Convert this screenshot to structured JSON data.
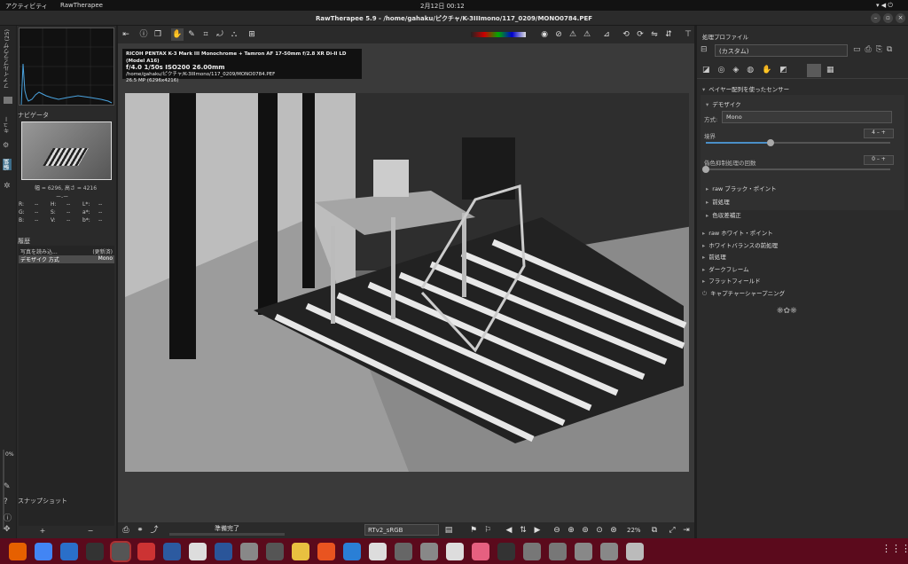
{
  "topbar": {
    "activities": "アクティビティ",
    "app": "RawTherapee",
    "clock": "2月12日  00:12"
  },
  "title": "RawTherapee 5.9 - /home/gahaku/ピクチャ/K-3IIImono/117_0209/MONO0784.PEF",
  "left_tabs": {
    "filebrowser": "ファイルブラウザ (25)",
    "queue": "キュー",
    "edit": "編集"
  },
  "left": {
    "navigator": "ナビゲータ",
    "size": "幅 = 6296, 高さ = 4216",
    "nan": "ー-ー",
    "readout": [
      [
        "R:",
        "--",
        "H:",
        "--",
        "L*:",
        "--"
      ],
      [
        "G:",
        "--",
        "S:",
        "--",
        "a*:",
        "--"
      ],
      [
        "B:",
        "--",
        "V:",
        "--",
        "b*:",
        "--"
      ]
    ],
    "history": "履歴",
    "history_items": [
      [
        "写真を読み込...",
        "(更新済)"
      ],
      [
        "デモザイク 方式",
        "Mono"
      ]
    ],
    "percent": "0%",
    "snapshot": "スナップショット",
    "plus": "+",
    "minus": "−"
  },
  "info": {
    "line1": "RICOH PENTAX K-3 Mark III Monochrome + Tamron AF 17-50mm f/2.8 XR Di-II LD (Model A16)",
    "line2": "f/4.0  1/50s  ISO200  26.00mm",
    "line3": "/home/gahaku/ピクチャ/K-3IIImono/117_0209/MONO0784.PEF",
    "line4": "26.5 MP (6296x4216)"
  },
  "bottom": {
    "status": "準備完了",
    "profile": "RTv2_sRGB",
    "zoom": "22%"
  },
  "right": {
    "profile_title": "処理プロファイル",
    "profile_value": "(カスタム)",
    "sensor": "ベイヤー配列を使ったセンサー",
    "demosaic": "デモザイク",
    "method_label": "方式:",
    "method_value": "Mono",
    "border_label": "境界",
    "border_value": "4",
    "border_fill": 0.35,
    "fcs_label": "偽色抑制処理の回数",
    "fcs_value": "0",
    "fcs_fill": 0.0,
    "sub": [
      "raw ブラック・ポイント",
      "前処理",
      "色収差補正"
    ],
    "sections": [
      "raw ホワイト・ポイント",
      "ホワイトバランスの前処理",
      "前処理",
      "ダークフレーム",
      "フラットフィールド",
      "キャプチャーシャープニング"
    ]
  }
}
